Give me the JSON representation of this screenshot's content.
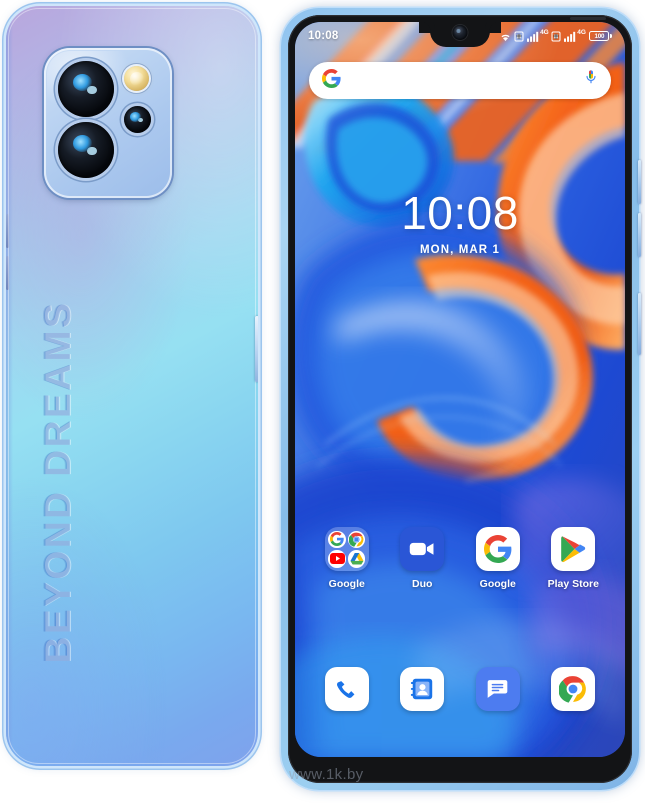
{
  "product": {
    "brand_tagline": "BEYOND DREAMS",
    "colorway_hex_back_start": "#b9a6dd",
    "colorway_hex_back_end": "#7fa2ec",
    "frame_hex": "#8fc3ef"
  },
  "watermark": {
    "text": "www.1k.by"
  },
  "back": {
    "camera_module": {
      "lens_main_name": "camera-lens-main",
      "lens_second_name": "camera-lens-secondary",
      "lens_macro_name": "camera-lens-macro",
      "flash_name": "camera-flash-led"
    }
  },
  "screen": {
    "statusbar": {
      "time": "10:08",
      "icons": [
        "wifi-icon",
        "sim1-icon",
        "signal-bars-icon",
        "4g-label",
        "sim2-icon",
        "signal-bars-icon",
        "4g-label",
        "battery-icon"
      ],
      "network_label_1": "4G",
      "network_label_2": "4G",
      "battery_percent": "100"
    },
    "search": {
      "placeholder": "",
      "value": "",
      "left_icon": "google-g-icon",
      "right_icon": "microphone-icon"
    },
    "clock_widget": {
      "time": "10:08",
      "date": "MON, MAR 1"
    },
    "app_row_1": [
      {
        "label": "Google",
        "icon": "google-folder-icon",
        "folder_items": [
          "google-g-icon",
          "chrome-icon",
          "youtube-icon",
          "drive-icon"
        ]
      },
      {
        "label": "Duo",
        "icon": "duo-video-icon"
      },
      {
        "label": "Google",
        "icon": "google-g-icon"
      },
      {
        "label": "Play Store",
        "icon": "play-store-icon"
      }
    ],
    "dock": [
      {
        "label": "",
        "icon": "phone-icon"
      },
      {
        "label": "",
        "icon": "contacts-icon"
      },
      {
        "label": "",
        "icon": "messages-icon"
      },
      {
        "label": "",
        "icon": "chrome-icon"
      }
    ]
  },
  "colors": {
    "google_blue": "#4285F4",
    "google_red": "#EA4335",
    "google_yellow": "#FBBC05",
    "google_green": "#34A853",
    "wallpaper_orange": "#F26A1B",
    "wallpaper_blue": "#1a4fd6"
  }
}
